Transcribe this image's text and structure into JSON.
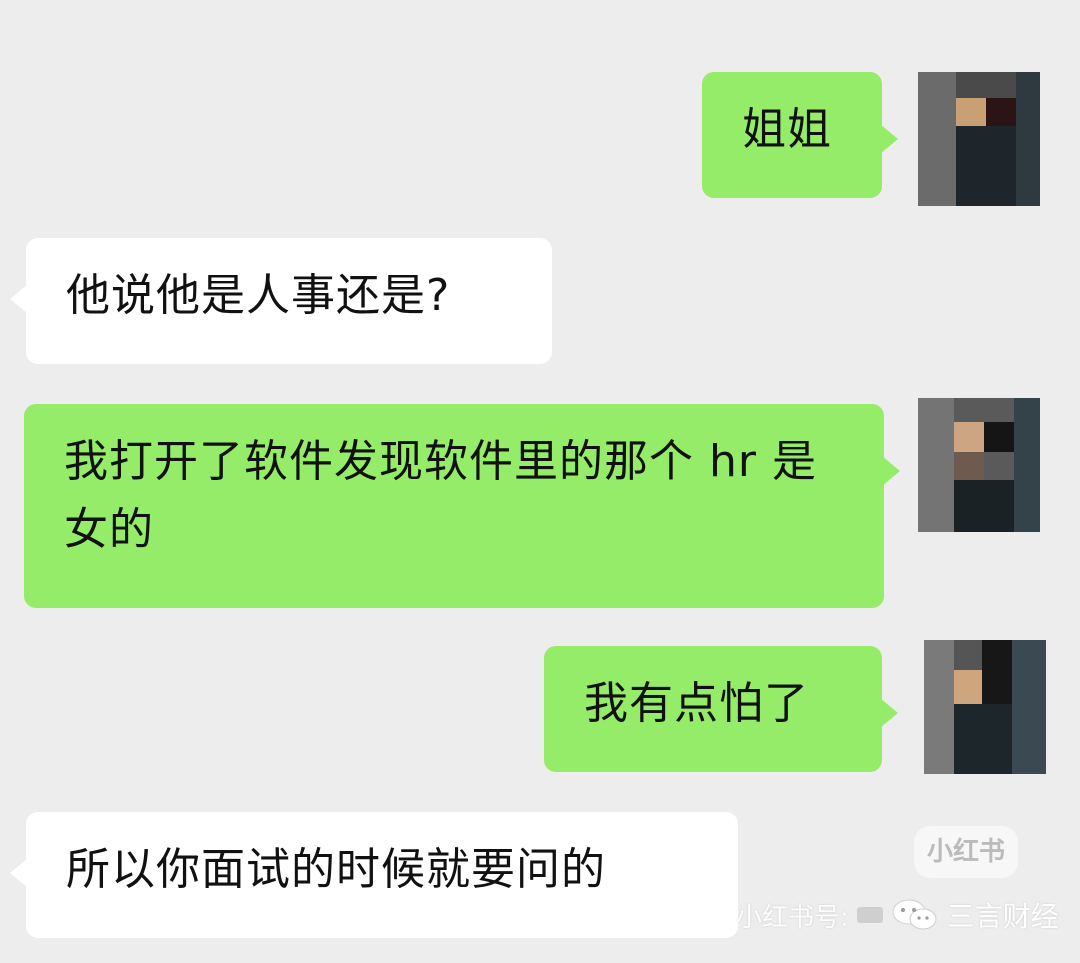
{
  "messages": [
    {
      "sender": "me",
      "text": "姐姐"
    },
    {
      "sender": "them",
      "text": "他说他是人事还是?"
    },
    {
      "sender": "me",
      "text": "我打开了软件发现软件里的那个 hr 是女的"
    },
    {
      "sender": "me",
      "text": "我有点怕了"
    },
    {
      "sender": "them",
      "text": "所以你面试的时候就要问的"
    }
  ],
  "watermark": {
    "logo_text": "小红书",
    "id_label": "小红书号:",
    "account_name": "三言财经"
  },
  "colors": {
    "background": "#ededed",
    "my_bubble": "#95ec69",
    "their_bubble": "#ffffff"
  },
  "icons": {
    "avatar": "pixelated-avatar",
    "wechat": "wechat-icon"
  }
}
